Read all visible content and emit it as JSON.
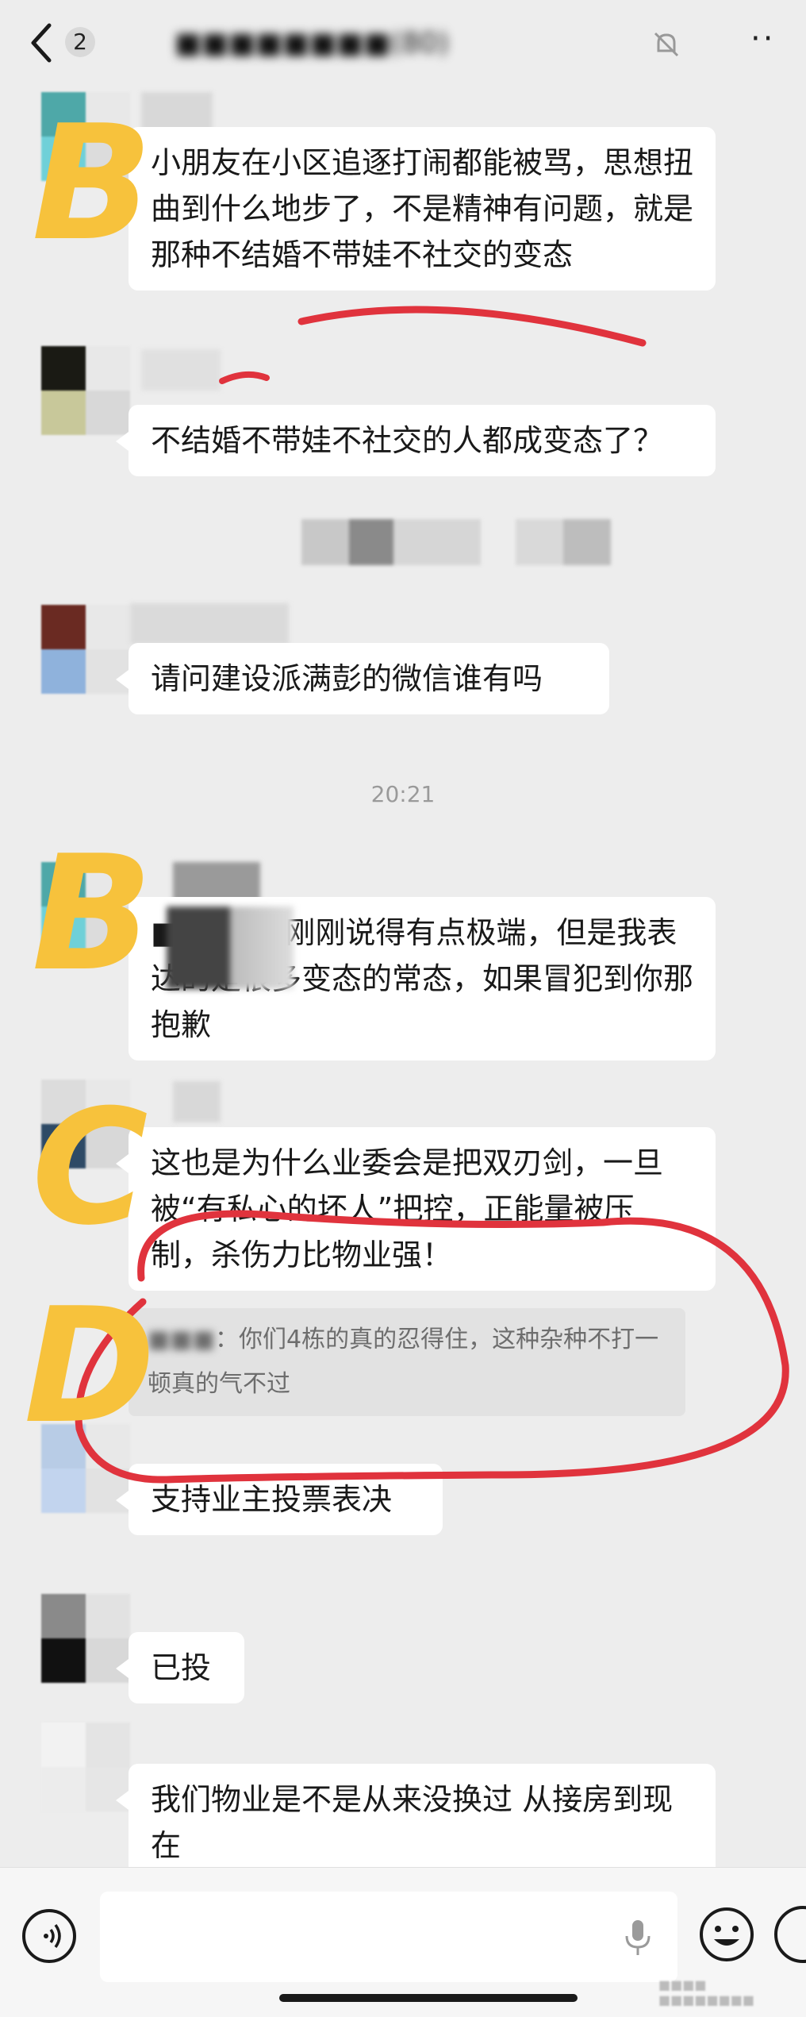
{
  "header": {
    "back_count": "2",
    "title": "■■■■■■■■(80)"
  },
  "timestamp": "20:21",
  "messages": [
    {
      "text": "小朋友在小区追逐打闹都能被骂，思想扭曲到什么地步了，不是精神有问题，就是那种不结婚不带娃不社交的变态"
    },
    {
      "text": "不结婚不带娃不社交的人都成变态了？"
    },
    {
      "text": "请问建设派满彭的微信谁有吗"
    },
    {
      "text": "■■■■- 刚刚说得有点极端，但是我表达的是很多变态的常态，如果冒犯到你那抱歉"
    },
    {
      "text": "这也是为什么业委会是把双刃剑，一旦被“有私心的坏人”把控，正能量被压制，杀伤力比物业强！"
    },
    {
      "text": "支持业主投票表决"
    },
    {
      "text": "已投"
    },
    {
      "text": "我们物业是不是从来没换过 从接房到现在"
    }
  ],
  "quote": {
    "sender": "■■■",
    "text": "：你们4栋的真的忍得住，这种杂种不打一顿真的气不过"
  },
  "annotations": {
    "b1": "B",
    "b2": "B",
    "c": "C",
    "d": "D"
  },
  "watermark": "■■■■ ■■■■■■■■",
  "colors": {
    "background": "#ededed",
    "bubble": "#ffffff",
    "annotation_yellow": "#f7c23c",
    "annotation_red": "#e0333d"
  }
}
